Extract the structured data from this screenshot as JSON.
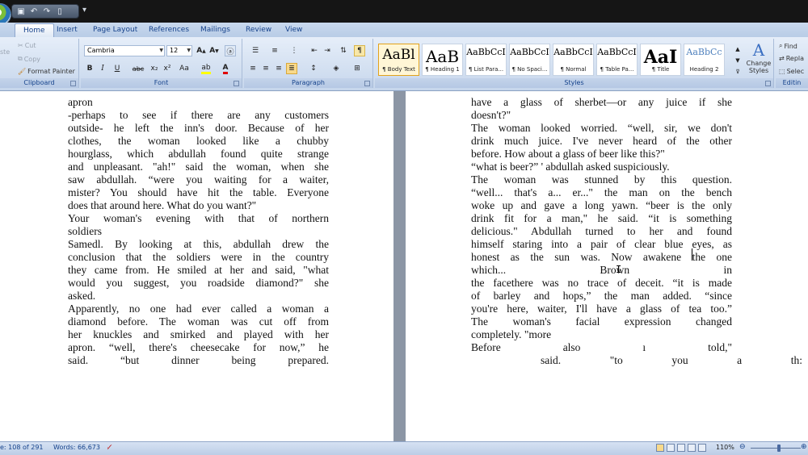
{
  "qat": {
    "icons": [
      "save-icon",
      "undo-icon",
      "redo-icon",
      "new-doc-icon"
    ]
  },
  "tabs": [
    "Home",
    "Insert",
    "Page Layout",
    "References",
    "Mailings",
    "Review",
    "View"
  ],
  "active_tab": "Home",
  "clipboard": {
    "label": "Clipboard",
    "paste": "ste",
    "cut": "Cut",
    "copy": "Copy",
    "format_painter": "Format Painter"
  },
  "font": {
    "label": "Font",
    "name": "Cambria",
    "size": "12",
    "buttons": [
      "B",
      "I",
      "U",
      "abc",
      "x₂",
      "x²",
      "Aa"
    ]
  },
  "paragraph": {
    "label": "Paragraph"
  },
  "styles": {
    "label": "Styles",
    "items": [
      {
        "sample": "AaBl",
        "name": "¶ Body Text",
        "selected": true
      },
      {
        "sample": "AaB",
        "name": "¶ Heading 1"
      },
      {
        "sample": "AaBbCcI",
        "name": "¶ List Para..."
      },
      {
        "sample": "AaBbCcI",
        "name": "¶ No Spaci..."
      },
      {
        "sample": "AaBbCcI",
        "name": "¶ Normal"
      },
      {
        "sample": "AaBbCcI",
        "name": "¶ Table Pa..."
      },
      {
        "sample": "AaI",
        "name": "¶ Title"
      },
      {
        "sample": "AaBbCc",
        "name": "Heading 2",
        "color": "#4f81bd"
      }
    ],
    "change_styles": "Change Styles"
  },
  "editing": {
    "label": "Editin",
    "find": "Find",
    "replace": "Repla",
    "select": "Selec"
  },
  "left_page": [
    {
      "t": "apron",
      "a": "l"
    },
    {
      "t": "-perhaps to see if there are any customers",
      "a": "j"
    },
    {
      "t": "outside- he left the inn's door. Because of her",
      "a": "j"
    },
    {
      "t": "clothes, the woman looked like a chubby",
      "a": "j"
    },
    {
      "t": "hourglass, which abdullah found quite strange",
      "a": "j"
    },
    {
      "t": "and unpleasant. \"ah!\" said the woman, when she",
      "a": "j"
    },
    {
      "t": "saw abdullah. “were you waiting for a waiter,",
      "a": "j"
    },
    {
      "t": "mister? You should have hit the table. Everyone",
      "a": "j"
    },
    {
      "t": "does that around here. What do you want?\"",
      "a": "l"
    },
    {
      "t": "Your woman's evening with that of northern",
      "a": "j"
    },
    {
      "t": "soldiers",
      "a": "l"
    },
    {
      "t": "Samedl. By looking at this, abdullah drew the",
      "a": "j"
    },
    {
      "t": "conclusion that the soldiers were in the country",
      "a": "j"
    },
    {
      "t": "they came from. He smiled at her and said, \"what",
      "a": "j"
    },
    {
      "t": "would you suggest, you roadside diamond?\" she",
      "a": "j"
    },
    {
      "t": "asked.",
      "a": "l"
    },
    {
      "t": "Apparently, no one had ever called a woman a",
      "a": "j"
    },
    {
      "t": "diamond before. The woman was cut off from",
      "a": "j"
    },
    {
      "t": "her knuckles and smirked and played with her",
      "a": "j"
    },
    {
      "t": "apron. “well, there's cheesecake for now,” he",
      "a": "j"
    },
    {
      "t": "said. “but dinner being prepared.",
      "a": "j"
    }
  ],
  "right_page": [
    {
      "t": "have a glass of sherbet—or any juice if she",
      "a": "j"
    },
    {
      "t": "doesn't?\"",
      "a": "l"
    },
    {
      "t": "The woman looked worried. “well, sir, we don't",
      "a": "j"
    },
    {
      "t": "drink much juice. I've never heard of the other",
      "a": "j"
    },
    {
      "t": "before. How about a glass of beer like this?\"",
      "a": "l"
    },
    {
      "t": "“what is beer?” ' abdullah asked suspiciously.",
      "a": "l"
    },
    {
      "t": "The woman was stunned by this question.",
      "a": "j"
    },
    {
      "t": "“well... that's a... er...\" the man on the bench",
      "a": "j"
    },
    {
      "t": "woke up and gave a long yawn. “beer is the only",
      "a": "j"
    },
    {
      "t": "drink fit for a man,\" he said. “it is something",
      "a": "j"
    },
    {
      "t": "delicious.\" Abdullah turned to her and found",
      "a": "j"
    },
    {
      "t": "himself staring into a pair of clear blue eyes, as",
      "a": "j"
    },
    {
      "t": "honest as the sun was. Now awakene the one",
      "a": "j"
    },
    {
      "t": "which... Brown in",
      "a": "j"
    },
    {
      "t": "the facethere was no trace of deceit. “it is made",
      "a": "j"
    },
    {
      "t": "of barley and hops,” the man added. “since",
      "a": "j"
    },
    {
      "t": "you're here, waiter, I'll have a glass of tea too.”",
      "a": "j"
    },
    {
      "t": "The woman's facial expression changed",
      "a": "j"
    },
    {
      "t": "completely. \"more",
      "a": "l"
    },
    {
      "t": "Before also ı told,\"",
      "a": "j"
    },
    {
      "t": "said. \"to you a th:",
      "a": "j",
      "indent": 86,
      "width": 410
    }
  ],
  "status": {
    "page": "e: 108 of 291",
    "words": "Words: 66,673",
    "zoom": "110%"
  }
}
